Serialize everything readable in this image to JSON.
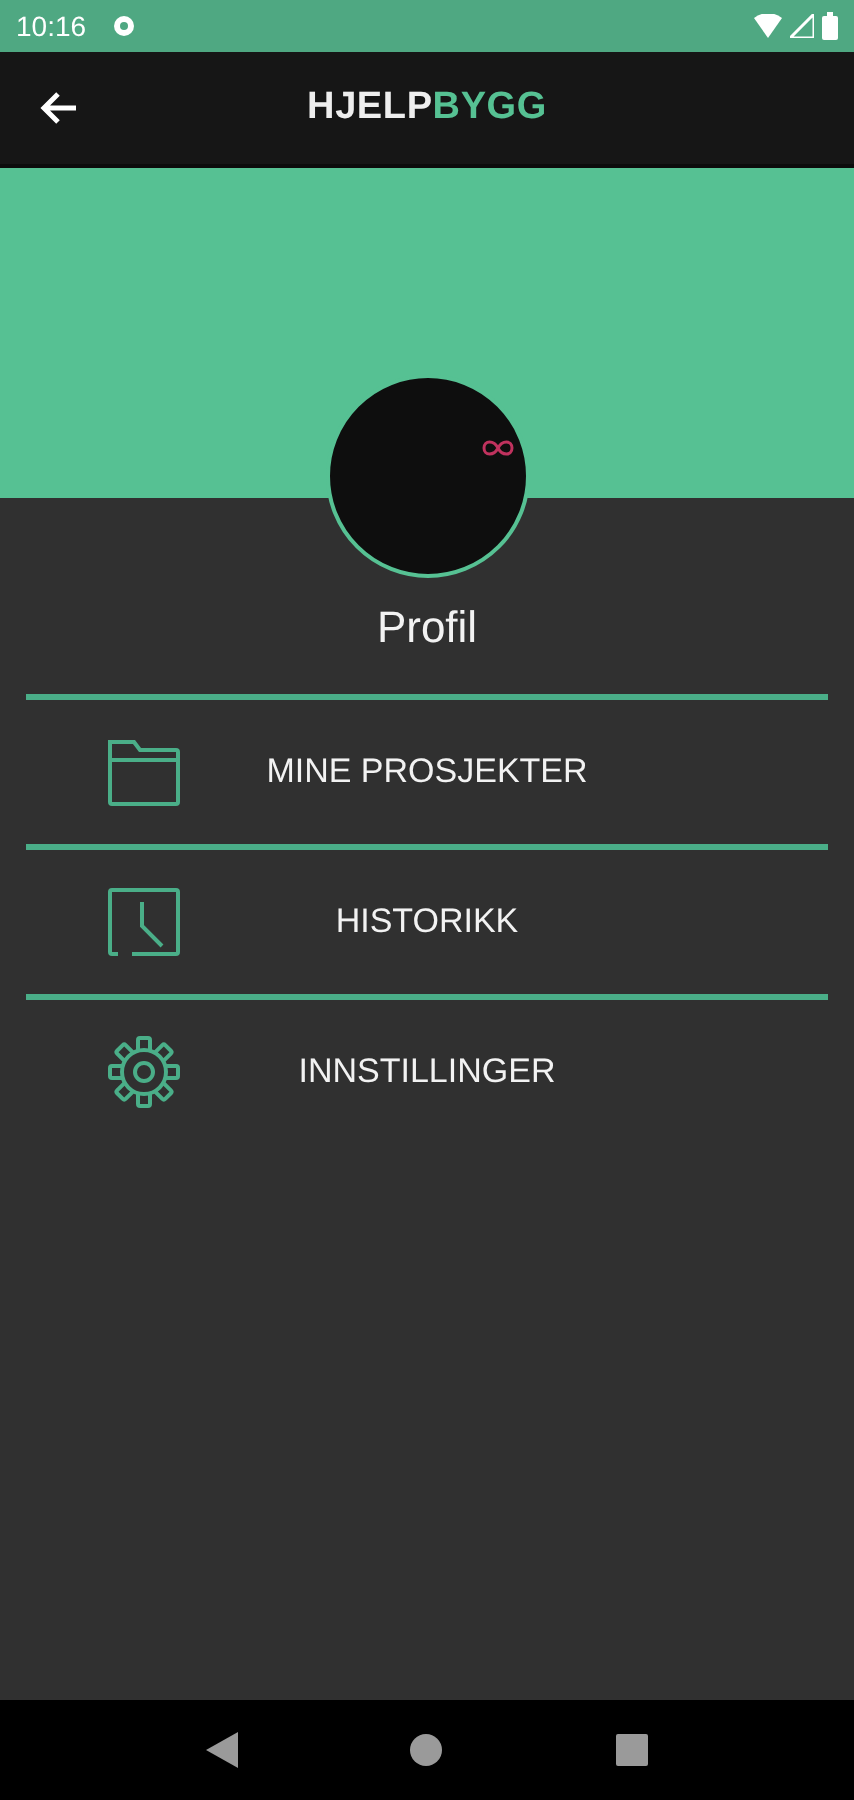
{
  "status_bar": {
    "time": "10:16"
  },
  "app_bar": {
    "title_first": "HJELP",
    "title_second": "BYGG"
  },
  "profile": {
    "label": "Profil"
  },
  "menu": [
    {
      "kind": "folder",
      "label": "MINE PROSJEKTER"
    },
    {
      "kind": "clock",
      "label": "HISTORIKK"
    },
    {
      "kind": "gear",
      "label": "INNSTILLINGER"
    }
  ]
}
